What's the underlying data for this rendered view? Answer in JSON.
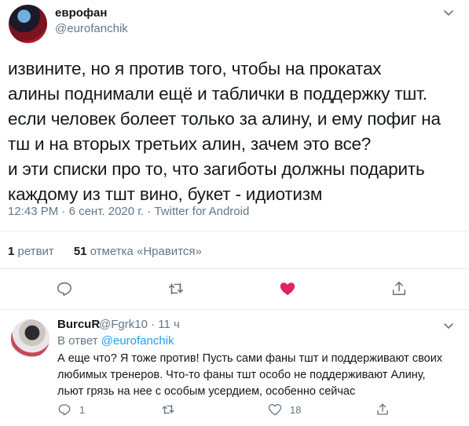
{
  "tweet": {
    "author_name": "еврофан",
    "author_handle": "@eurofanchik",
    "text": "извините, но я против того, чтобы на прокатах\nалины поднимали ещё и таблички в поддержку тшт.\nесли человек болеет только за алину, и ему пофиг на\nтш и на вторых третьих алин, зачем это все?\nи эти списки про то, что загиботы должны подарить\nкаждому из тшт вино, букет - идиотизм",
    "time": "12:43 PM",
    "separator": "·",
    "date": "6 сент. 2020 г.",
    "source": "Twitter for Android",
    "retweets_count": "1",
    "retweets_label": "ретвит",
    "likes_count": "51",
    "likes_label": "отметка «Нравится»"
  },
  "reply": {
    "author_name": "BurcuR",
    "author_handle": "@Fgrk10",
    "time_sep": "·",
    "time_ago": "11 ч",
    "reply_to_label": "В ответ",
    "reply_to_handle": "@eurofanchik",
    "text": "А еще что? Я тоже против! Пусть сами фаны тшт и поддерживают своих\nлюбимых тренеров. Что-то фаны тшт особо не поддерживают Алину,\nльют грязь на нее с особым усердием, особенно сейчас",
    "reply_count": "1",
    "like_count": "18"
  },
  "colors": {
    "text": "#14171a",
    "secondary": "#657786",
    "link": "#1da1f2",
    "like_active": "#e0245e",
    "divider": "#e6ecf0"
  },
  "icons": {
    "caret": "chevron-down-icon",
    "reply": "speech-bubble-icon",
    "retweet": "retweet-icon",
    "like": "heart-icon",
    "share": "share-icon"
  }
}
